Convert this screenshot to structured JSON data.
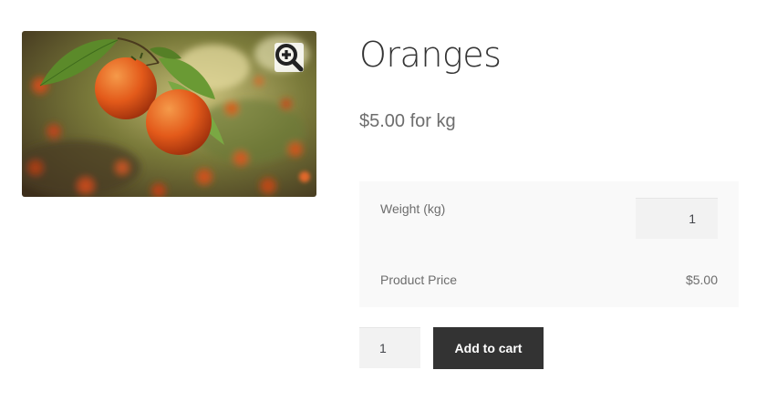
{
  "product": {
    "title": "Oranges",
    "price_text": "$5.00 for kg",
    "image_alt": "Oranges hanging on a tree branch",
    "zoom_icon": "magnifier-plus-icon"
  },
  "addons": {
    "weight_label": "Weight (kg)",
    "weight_value": "1",
    "price_label": "Product Price",
    "price_value": "$5.00"
  },
  "cart": {
    "quantity": "1",
    "add_to_cart_label": "Add to cart"
  },
  "colors": {
    "button_bg": "#333333",
    "addon_bg": "#f9f9f9",
    "input_bg": "#f2f2f2",
    "orange": "#e4591b"
  }
}
